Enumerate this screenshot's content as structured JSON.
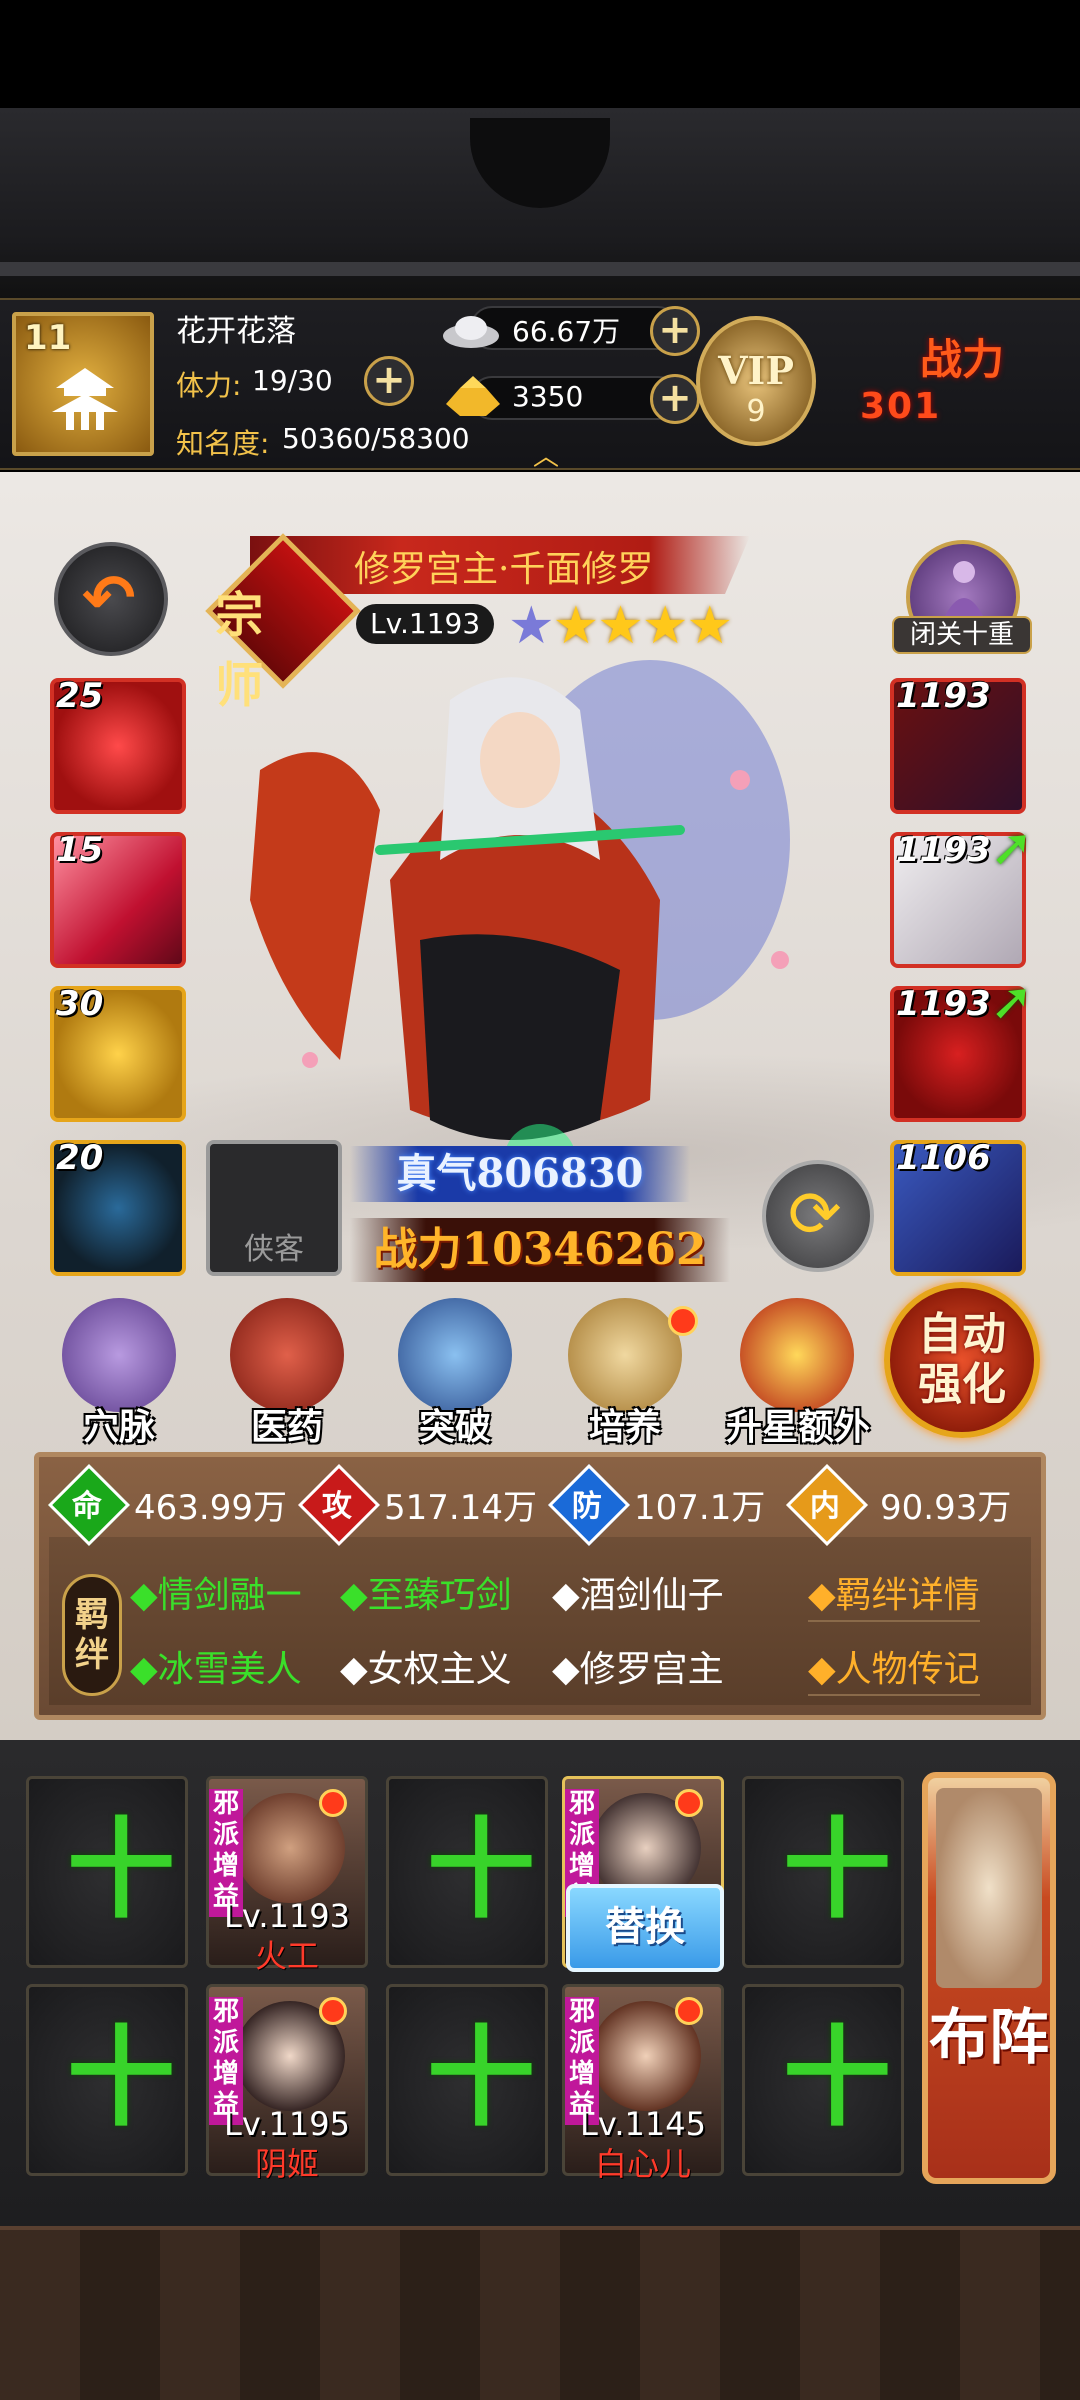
{
  "player": {
    "level": "11",
    "name": "花开花落",
    "stamina_label": "体力:",
    "stamina_value": "19/30",
    "fame_label": "知名度:",
    "fame_value": "50360/58300",
    "silver": "66.67万",
    "gold": "3350",
    "vip_label": "VIP",
    "vip_level": "9",
    "power_label": "战力",
    "power_value": "301"
  },
  "hero": {
    "rank_badge": "宗师",
    "name": "修罗宫主·千面修罗",
    "level": "Lv.1193",
    "stars_total": 5,
    "stars_gold": 4,
    "meditate_label": "闭关十重",
    "zhenqi": "真气806830",
    "battle_power": "战力10346262",
    "xiake_label": "侠客"
  },
  "skills": [
    {
      "level": "25"
    },
    {
      "level": "15"
    },
    {
      "level": "30"
    },
    {
      "level": "20"
    }
  ],
  "equipment": [
    {
      "level": "1193"
    },
    {
      "level": "1193"
    },
    {
      "level": "1193"
    },
    {
      "level": "1106"
    }
  ],
  "actions": [
    {
      "label": "穴脉",
      "icon": "meridian-icon"
    },
    {
      "label": "医药",
      "icon": "medicine-icon"
    },
    {
      "label": "突破",
      "icon": "breakthrough-icon"
    },
    {
      "label": "培养",
      "icon": "training-icon"
    },
    {
      "label": "升星额外",
      "icon": "star-up-icon"
    }
  ],
  "auto_enhance": "自动强化",
  "stats": [
    {
      "icon": "命",
      "value": "463.99万",
      "color": "#1aa81a"
    },
    {
      "icon": "攻",
      "value": "517.14万",
      "color": "#c81a1a"
    },
    {
      "icon": "防",
      "value": "107.1万",
      "color": "#1a6ad8"
    },
    {
      "icon": "内",
      "value": "90.93万",
      "color": "#e69a1a"
    }
  ],
  "bonds": {
    "tag": "羁绊",
    "row1": [
      {
        "text": "◆情剑融一",
        "active": true
      },
      {
        "text": "◆至臻巧剑",
        "active": true
      },
      {
        "text": "◆酒剑仙子",
        "active": false
      }
    ],
    "row2": [
      {
        "text": "◆冰雪美人",
        "active": true
      },
      {
        "text": "◆女权主义",
        "active": false
      },
      {
        "text": "◆修罗宫主",
        "active": false
      }
    ],
    "detail_link": "◆羁绊详情",
    "biography_link": "◆人物传记"
  },
  "formation": {
    "plus": "十",
    "evil_tag": "邪派增益",
    "heroes": [
      {
        "level": "Lv.1193",
        "name": "火工"
      },
      {
        "level": "Lv.1195",
        "name": "阴姬"
      },
      {
        "level": "Lv.1145",
        "name": "白心儿"
      }
    ],
    "replace_label": "替换",
    "arrange_label": "布阵"
  }
}
